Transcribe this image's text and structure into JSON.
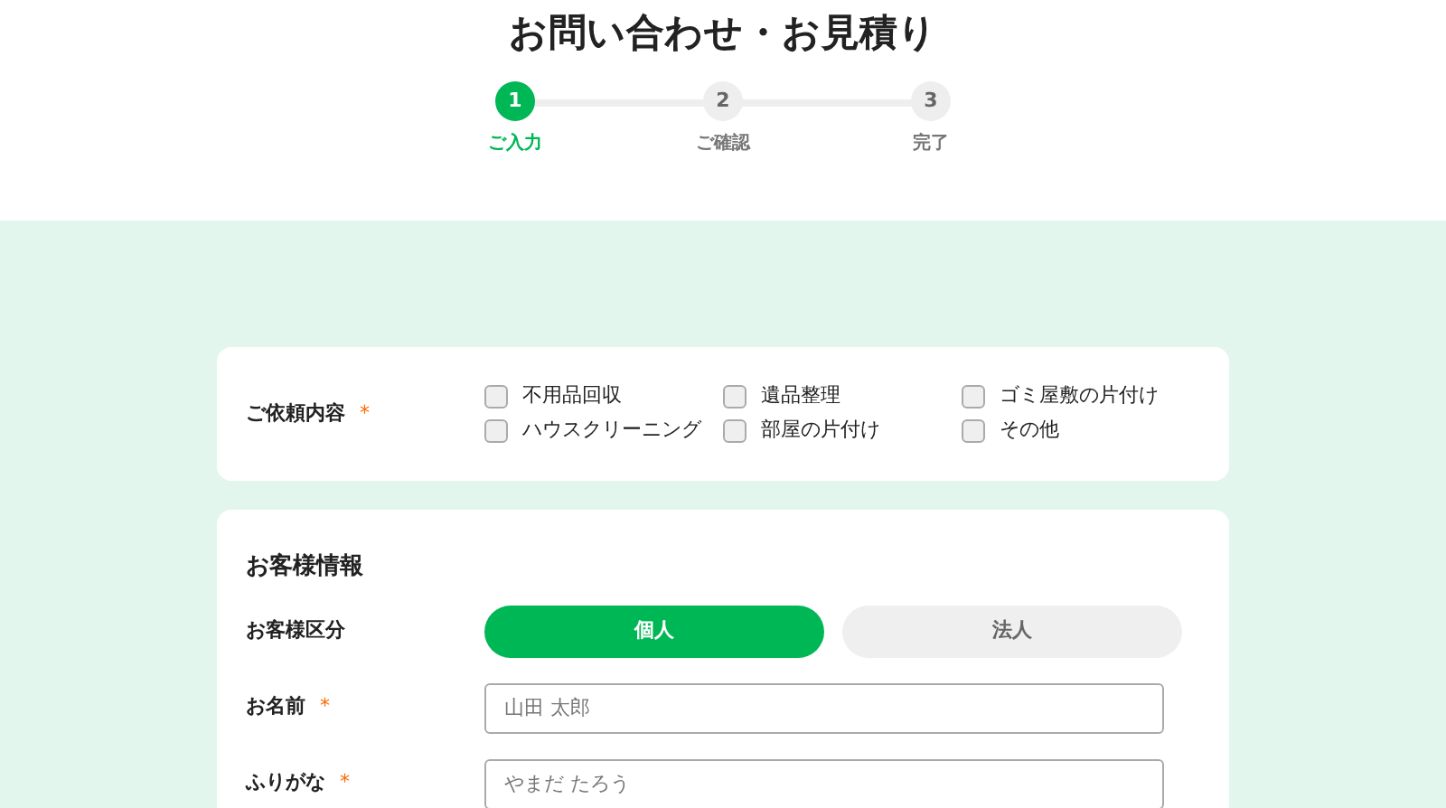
{
  "title": "お問い合わせ・お見積り",
  "steps": [
    {
      "number": "1",
      "label": "ご入力",
      "selected": true
    },
    {
      "number": "2",
      "label": "ご確認",
      "selected": false
    },
    {
      "number": "3",
      "label": "完了",
      "selected": false
    }
  ],
  "request": {
    "label": "ご依頼内容",
    "required_mark": "*",
    "options": [
      {
        "label": "不用品回収",
        "checked": false
      },
      {
        "label": "遺品整理",
        "checked": false
      },
      {
        "label": "ゴミ屋敷の片付け",
        "checked": false
      },
      {
        "label": "ハウスクリーニング",
        "checked": false
      },
      {
        "label": "部屋の片付け",
        "checked": false
      },
      {
        "label": "その他",
        "checked": false
      }
    ]
  },
  "customer": {
    "heading": "お客様情報",
    "type_label": "お客様区分",
    "types": [
      {
        "label": "個人",
        "selected": true
      },
      {
        "label": "法人",
        "selected": false
      }
    ],
    "fields": [
      {
        "label": "お名前",
        "required_mark": "*",
        "placeholder": "山田 太郎"
      },
      {
        "label": "ふりがな",
        "required_mark": "*",
        "placeholder": "やまだ たろう"
      }
    ]
  }
}
